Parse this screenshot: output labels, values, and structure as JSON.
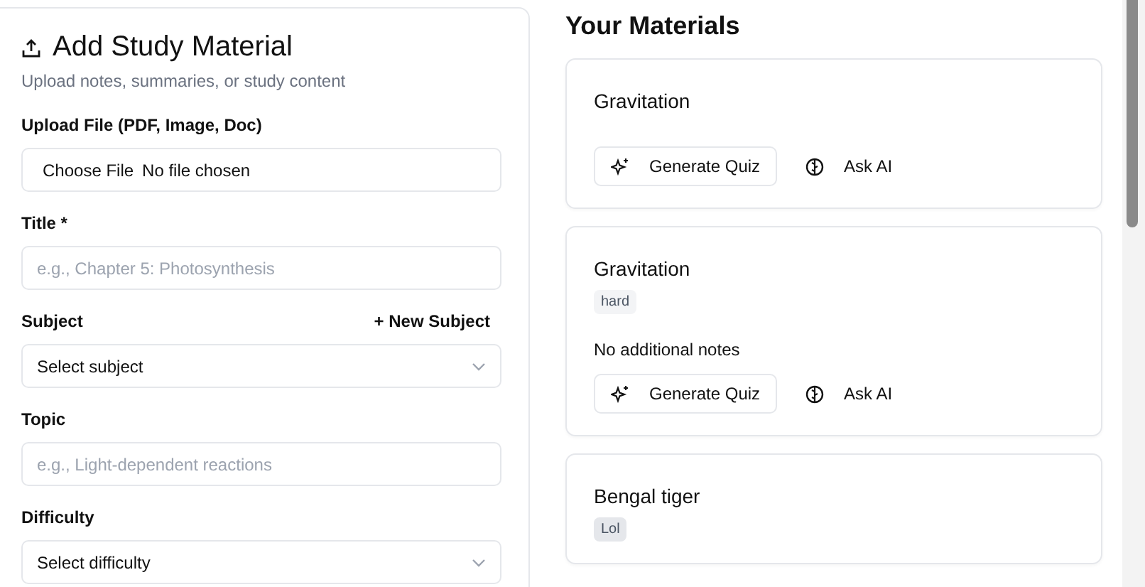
{
  "form": {
    "title": "Add Study Material",
    "subtitle": "Upload notes, summaries, or study content",
    "fields": [
      {
        "kind": "file",
        "label": "Upload File (PDF, Image, Doc)",
        "button": "Choose File",
        "value": "No file chosen"
      },
      {
        "kind": "text",
        "label": "Title *",
        "placeholder": "e.g., Chapter 5: Photosynthesis"
      },
      {
        "kind": "select",
        "label": "Subject",
        "action": "+ New Subject",
        "placeholder": "Select subject"
      },
      {
        "kind": "text",
        "label": "Topic",
        "placeholder": "e.g., Light-dependent reactions"
      },
      {
        "kind": "select",
        "label": "Difficulty",
        "placeholder": "Select difficulty"
      }
    ]
  },
  "materials": {
    "title": "Your Materials",
    "items": [
      {
        "title": "Gravitation",
        "actions": [
          "Generate Quiz",
          "Ask AI"
        ]
      },
      {
        "title": "Gravitation",
        "tag": {
          "label": "hard",
          "color": "#f3f4f6"
        },
        "notes": "No additional notes",
        "actions": [
          "Generate Quiz",
          "Ask AI"
        ]
      },
      {
        "title": "Bengal tiger",
        "tag": {
          "label": "Lol",
          "color": "#e5e7eb"
        }
      }
    ]
  }
}
